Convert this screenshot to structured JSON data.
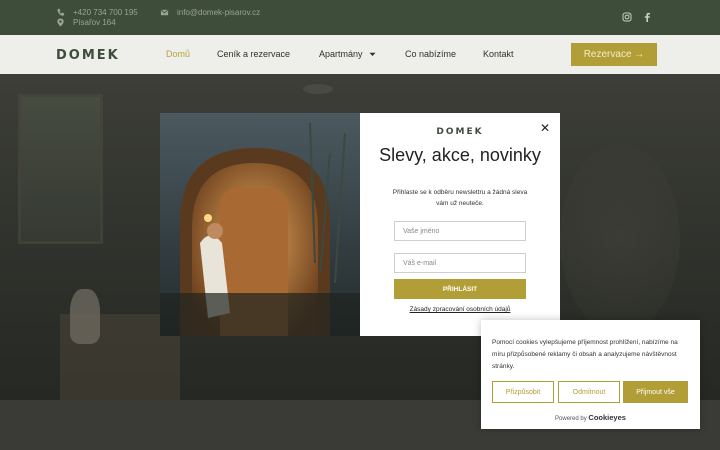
{
  "topbar": {
    "phone": "+420 734 700 195",
    "email": "info@domek-pisarov.cz",
    "address": "Písařov 164"
  },
  "nav": {
    "logo": "DOMEK",
    "links": [
      "Domů",
      "Ceník a rezervace",
      "Apartmány",
      "Co nabízíme",
      "Kontakt"
    ],
    "cta": "Rezervace →"
  },
  "popup": {
    "logo": "DOMEK",
    "title": "Slevy, akce, novinky",
    "subtitle": "Přihlaste se k odběru newslettru a žádná sleva vám už neuteče.",
    "name_placeholder": "Vaše jméno",
    "email_placeholder": "Váš e-mail",
    "submit": "PŘIHLÁSIT",
    "policy": "Zásady zpracování osobních údajů",
    "close": "✕"
  },
  "cookie": {
    "text": "Pomocí cookies vylepšujeme příjemnost prohlížení, nabízíme na míru přizpůsobené reklamy či obsah a analyzujeme návštěvnost stránky.",
    "customize": "Přizpůsobit",
    "reject": "Odmítnout",
    "accept": "Přijmout vše",
    "powered_by": "Powered by",
    "brand": "Cookieyes"
  },
  "colors": {
    "brand_green": "#3e4d3a",
    "gold": "#b19e36"
  }
}
